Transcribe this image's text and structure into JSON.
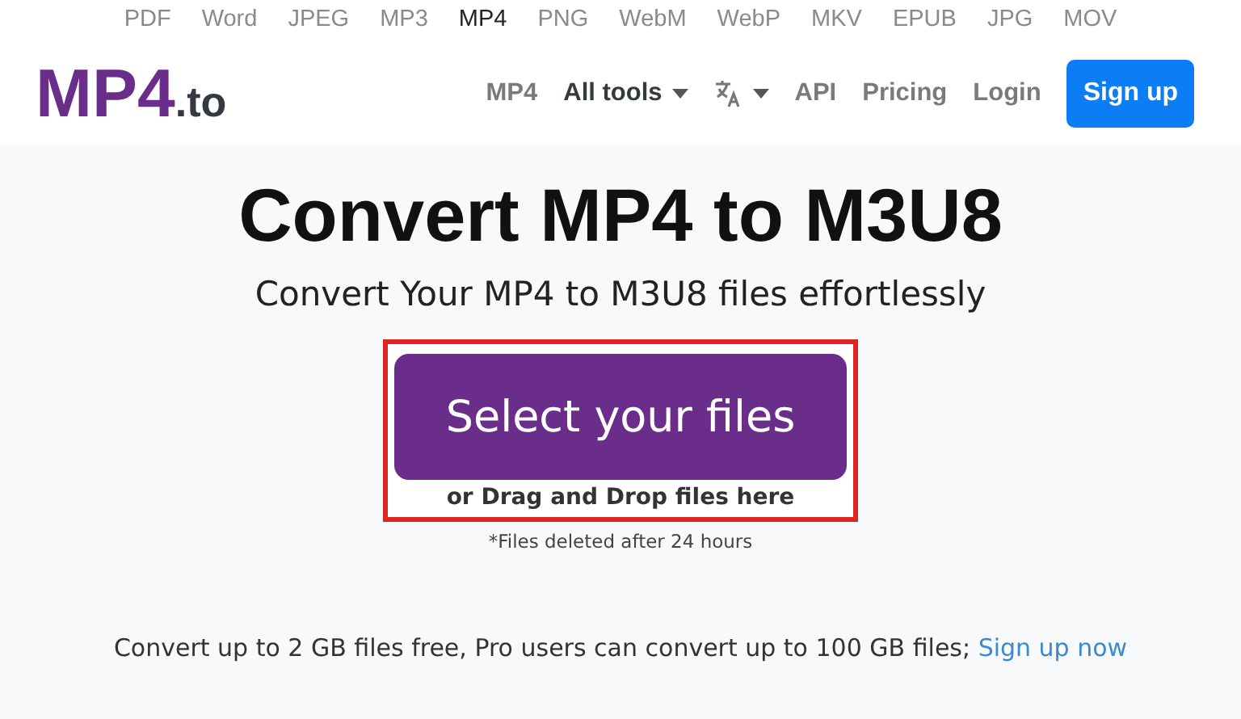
{
  "formats": [
    {
      "label": "PDF",
      "selected": false
    },
    {
      "label": "Word",
      "selected": false
    },
    {
      "label": "JPEG",
      "selected": false
    },
    {
      "label": "MP3",
      "selected": false
    },
    {
      "label": "MP4",
      "selected": true
    },
    {
      "label": "PNG",
      "selected": false
    },
    {
      "label": "WebM",
      "selected": false
    },
    {
      "label": "WebP",
      "selected": false
    },
    {
      "label": "MKV",
      "selected": false
    },
    {
      "label": "EPUB",
      "selected": false
    },
    {
      "label": "JPG",
      "selected": false
    },
    {
      "label": "MOV",
      "selected": false
    }
  ],
  "logo": {
    "main": "MP4",
    "suffix": ".to"
  },
  "nav": [
    {
      "kind": "link",
      "label": "MP4",
      "emphasis": false
    },
    {
      "kind": "dropdown",
      "label": "All tools",
      "emphasis": true
    },
    {
      "kind": "language"
    },
    {
      "kind": "link",
      "label": "API",
      "emphasis": false
    },
    {
      "kind": "link",
      "label": "Pricing",
      "emphasis": false
    },
    {
      "kind": "link",
      "label": "Login",
      "emphasis": false
    },
    {
      "kind": "button",
      "label": "Sign up"
    }
  ],
  "hero": {
    "title": "Convert MP4 to M3U8",
    "subtitle": "Convert Your MP4 to M3U8 files effortlessly"
  },
  "upload": {
    "button": "Select your files",
    "hint": "or Drag and Drop files here",
    "highlighted": true
  },
  "note": "*Files deleted after 24 hours",
  "footer": {
    "text": "Convert up to 2 GB files free, Pro users can convert up to 100 GB files; ",
    "link": "Sign up now"
  }
}
